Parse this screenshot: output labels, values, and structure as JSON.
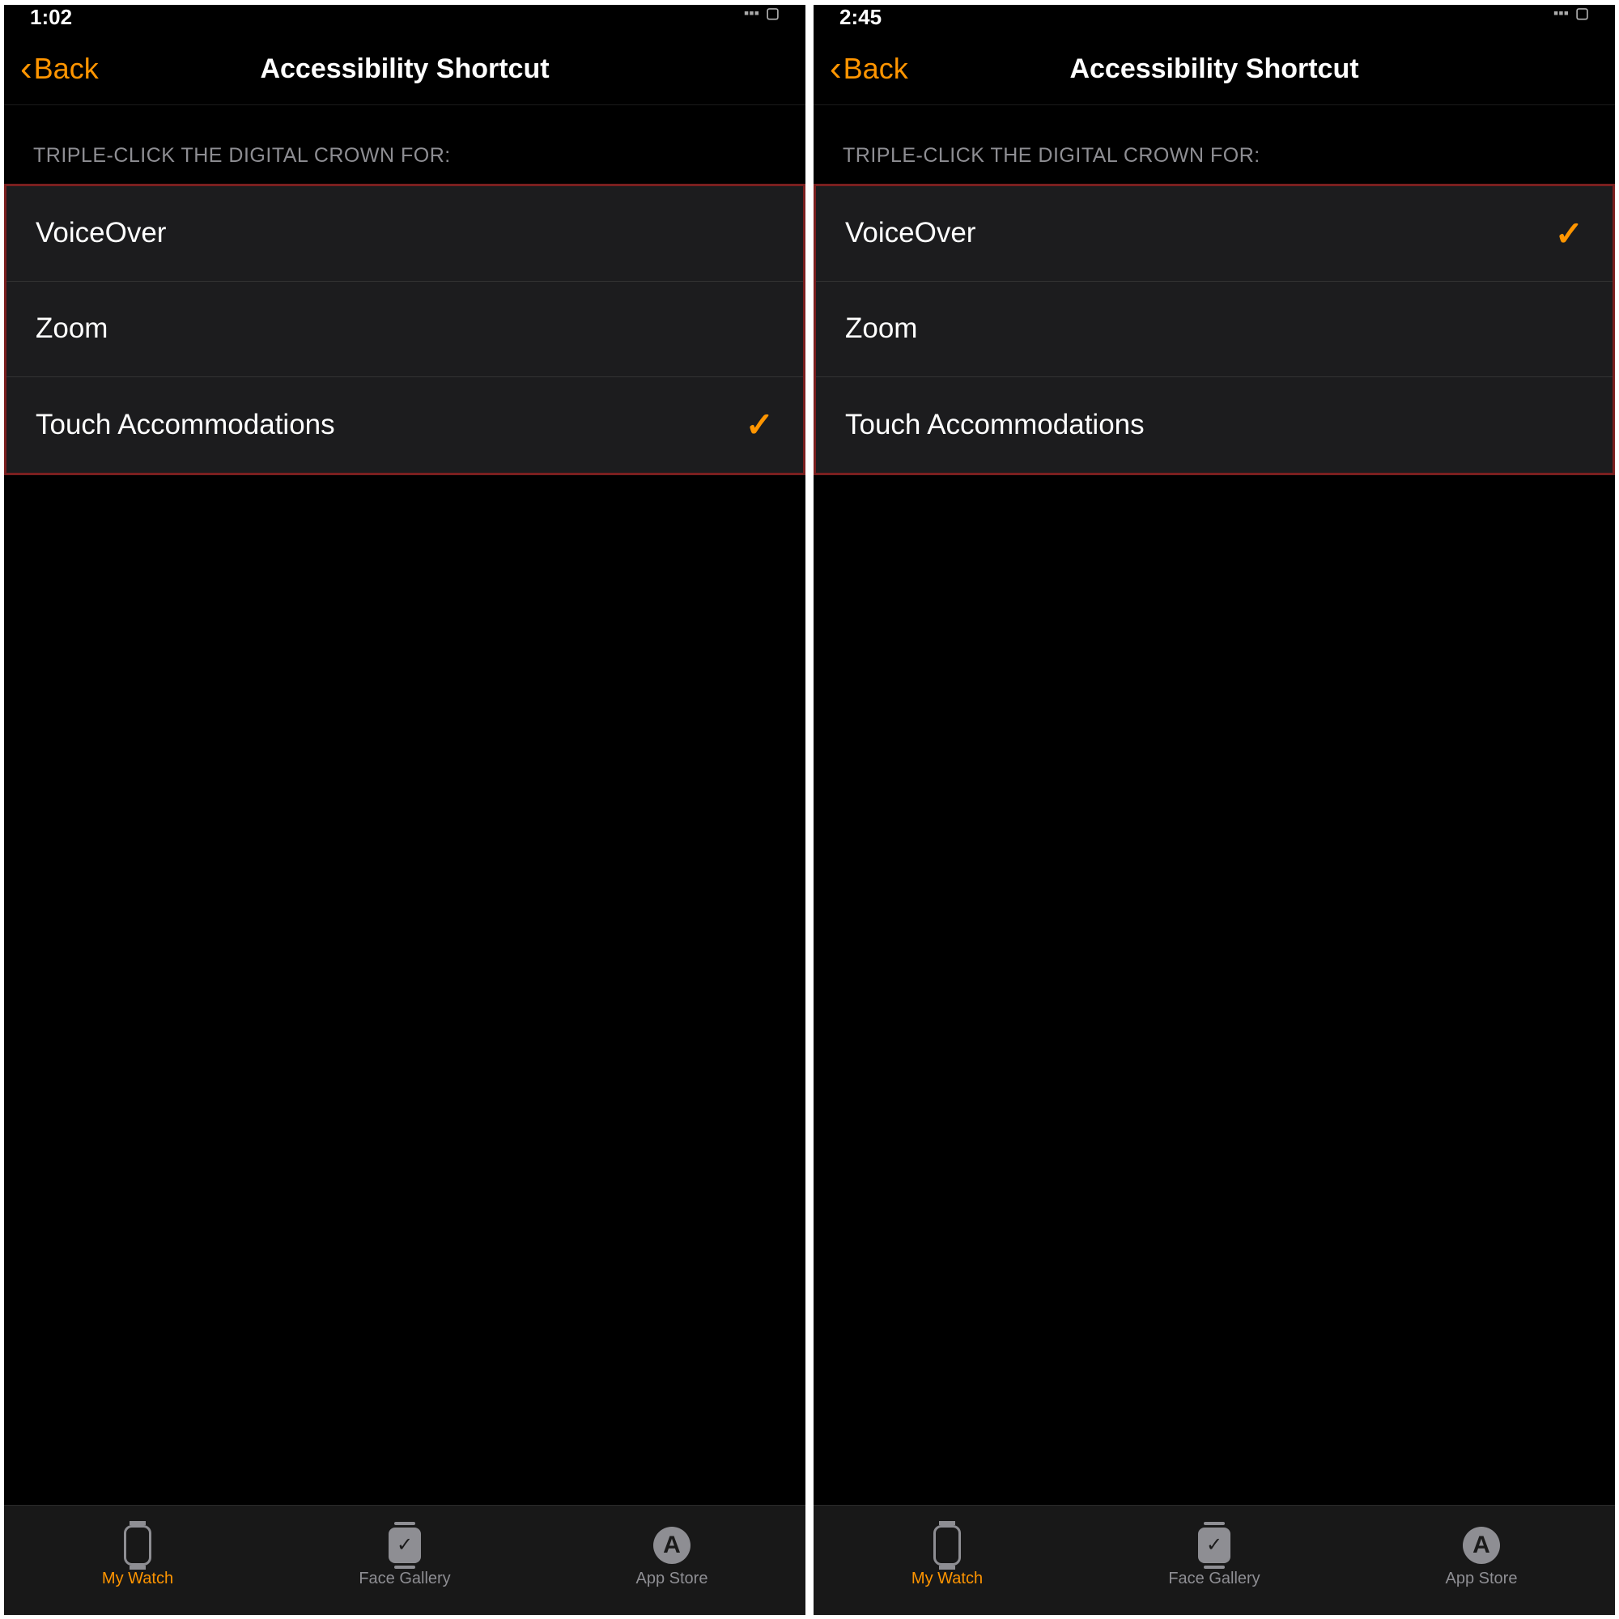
{
  "left": {
    "status_time": "1:02",
    "back_label": "Back",
    "title": "Accessibility Shortcut",
    "section_header": "TRIPLE-CLICK THE DIGITAL CROWN FOR:",
    "options": [
      {
        "label": "VoiceOver",
        "checked": false
      },
      {
        "label": "Zoom",
        "checked": false
      },
      {
        "label": "Touch Accommodations",
        "checked": true
      }
    ]
  },
  "right": {
    "status_time": "2:45",
    "back_label": "Back",
    "title": "Accessibility Shortcut",
    "section_header": "TRIPLE-CLICK THE DIGITAL CROWN FOR:",
    "options": [
      {
        "label": "VoiceOver",
        "checked": true
      },
      {
        "label": "Zoom",
        "checked": false
      },
      {
        "label": "Touch Accommodations",
        "checked": false
      }
    ]
  },
  "tabs": {
    "my_watch": "My Watch",
    "face_gallery": "Face Gallery",
    "app_store": "App Store"
  },
  "checkmark": "✓",
  "gallery_check": "✓",
  "appstore_a": "A"
}
